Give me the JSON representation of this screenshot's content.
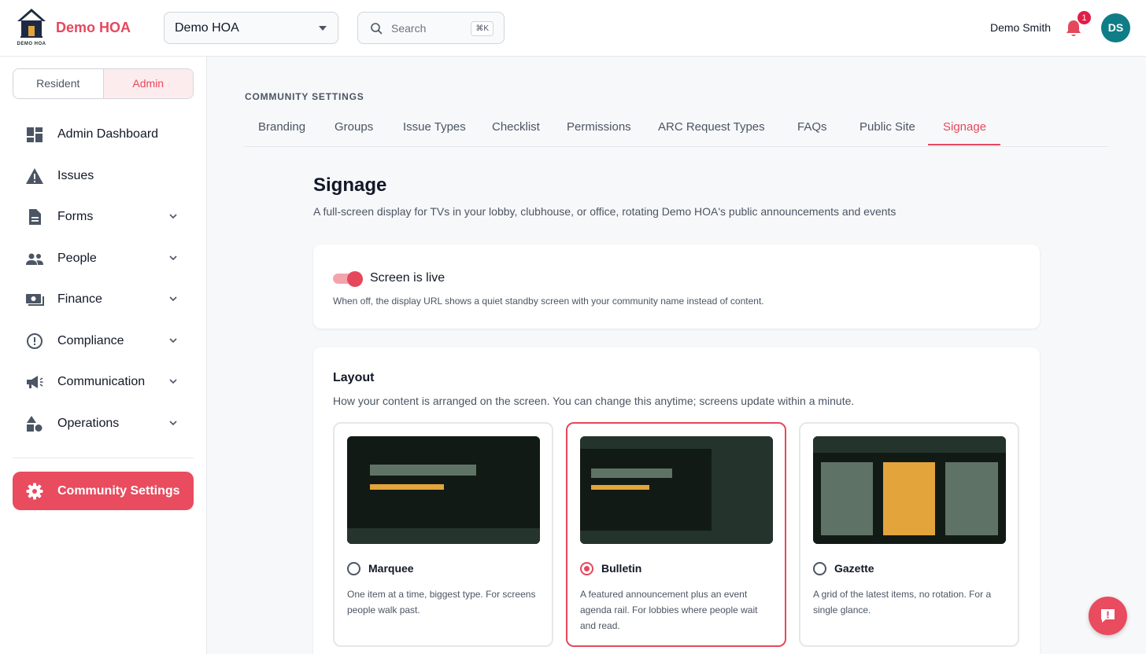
{
  "header": {
    "brand": "Demo HOA",
    "logo_caption": "DEMO HOA",
    "org_selector_value": "Demo HOA",
    "search_placeholder": "Search",
    "search_shortcut": "⌘K",
    "user_name": "Demo Smith",
    "notification_count": "1",
    "avatar_initials": "DS"
  },
  "sidebar": {
    "roles": [
      "Resident",
      "Admin"
    ],
    "active_role": "Admin",
    "items": [
      {
        "label": "Admin Dashboard",
        "icon": "dashboard-icon",
        "expandable": false
      },
      {
        "label": "Issues",
        "icon": "warning-icon",
        "expandable": false
      },
      {
        "label": "Forms",
        "icon": "document-icon",
        "expandable": true
      },
      {
        "label": "People",
        "icon": "people-icon",
        "expandable": true
      },
      {
        "label": "Finance",
        "icon": "money-icon",
        "expandable": true
      },
      {
        "label": "Compliance",
        "icon": "alert-circle-icon",
        "expandable": true
      },
      {
        "label": "Communication",
        "icon": "megaphone-icon",
        "expandable": true
      },
      {
        "label": "Operations",
        "icon": "shapes-icon",
        "expandable": true
      }
    ],
    "settings_label": "Community Settings"
  },
  "main": {
    "section_label": "COMMUNITY SETTINGS",
    "tabs": [
      "Branding",
      "Groups",
      "Issue Types",
      "Checklist",
      "Permissions",
      "ARC Request Types",
      "FAQs",
      "Public Site",
      "Signage"
    ],
    "active_tab": "Signage",
    "title": "Signage",
    "subtitle": "A full-screen display for TVs in your lobby, clubhouse, or office, rotating Demo HOA's public announcements and events",
    "live_card": {
      "toggle_on": true,
      "label": "Screen is live",
      "description": "When off, the display URL shows a quiet standby screen with your community name instead of content."
    },
    "layout_card": {
      "title": "Layout",
      "description": "How your content is arranged on the screen. You can change this anytime; screens update within a minute.",
      "selected": "Bulletin",
      "options": [
        {
          "name": "Marquee",
          "description": "One item at a time, biggest type. For screens people walk past."
        },
        {
          "name": "Bulletin",
          "description": "A featured announcement plus an event agenda rail. For lobbies where people wait and read."
        },
        {
          "name": "Gazette",
          "description": "A grid of the latest items, no rotation. For a single glance."
        }
      ]
    }
  },
  "colors": {
    "accent": "#e5485d",
    "avatar": "#0f7d86",
    "thumb_bg": "#121a16",
    "thumb_muted": "#5f7266",
    "thumb_highlight": "#e3a43b"
  }
}
